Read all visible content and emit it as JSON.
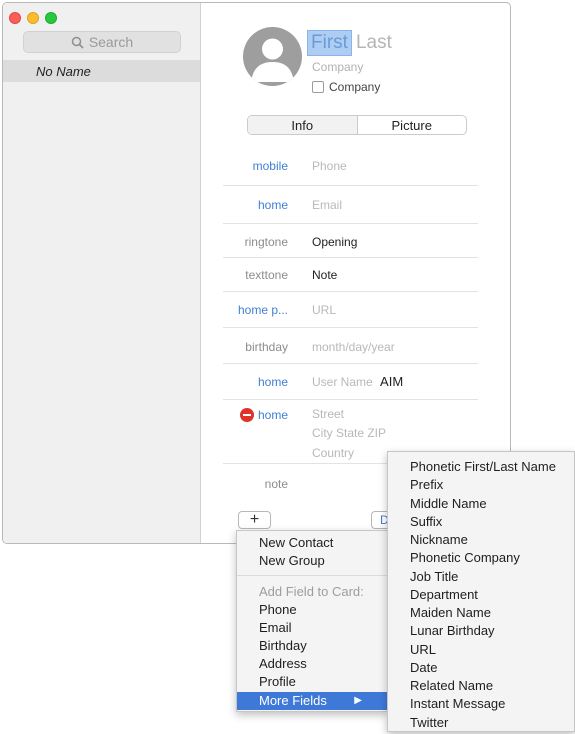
{
  "sidebar": {
    "search_placeholder": "Search",
    "items": [
      {
        "label": "No Name"
      }
    ]
  },
  "card": {
    "first_placeholder": "First",
    "last_placeholder": "Last",
    "company_placeholder": "Company",
    "company_checkbox_label": "Company",
    "company_checked": false,
    "tabs": [
      {
        "label": "Info",
        "selected": true
      },
      {
        "label": "Picture",
        "selected": false
      }
    ],
    "fields": [
      {
        "label": "mobile",
        "value": "Phone",
        "placeholder": true
      },
      {
        "label": "home",
        "value": "Email",
        "placeholder": true
      },
      {
        "label": "ringtone",
        "value": "Opening",
        "placeholder": false
      },
      {
        "label": "texttone",
        "value": "Note",
        "placeholder": false
      },
      {
        "label": "home p...",
        "value": "URL",
        "placeholder": true
      },
      {
        "label": "birthday",
        "value": "month/day/year",
        "placeholder": true
      },
      {
        "label": "home",
        "value": "User Name",
        "suffix": "AIM",
        "placeholder": true
      },
      {
        "label": "home",
        "lines": [
          "Street",
          "City  State  ZIP",
          "Country"
        ],
        "placeholder": true
      },
      {
        "label": "note",
        "value": "",
        "placeholder": true
      }
    ],
    "plus_label": "+",
    "done_label": "Do"
  },
  "menu": {
    "items": [
      {
        "label": "New Contact"
      },
      {
        "label": "New Group"
      },
      {
        "label": "Add Field to Card:",
        "disabled": true
      },
      {
        "label": "Phone"
      },
      {
        "label": "Email"
      },
      {
        "label": "Birthday"
      },
      {
        "label": "Address"
      },
      {
        "label": "Profile"
      },
      {
        "label": "More Fields",
        "highlighted": true,
        "arrow": "▶"
      }
    ]
  },
  "submenu": {
    "items": [
      {
        "label": "Phonetic First/Last Name"
      },
      {
        "label": "Prefix"
      },
      {
        "label": "Middle Name"
      },
      {
        "label": "Suffix"
      },
      {
        "label": "Nickname"
      },
      {
        "label": "Phonetic Company"
      },
      {
        "label": "Job Title"
      },
      {
        "label": "Department"
      },
      {
        "label": "Maiden Name"
      },
      {
        "label": "Lunar Birthday"
      },
      {
        "label": "URL"
      },
      {
        "label": "Date"
      },
      {
        "label": "Related Name"
      },
      {
        "label": "Instant Message"
      },
      {
        "label": "Twitter"
      }
    ]
  },
  "colors": {
    "accent": "#3f7fd5",
    "highlight": "#3f79d8",
    "remove": "#e0332a"
  }
}
